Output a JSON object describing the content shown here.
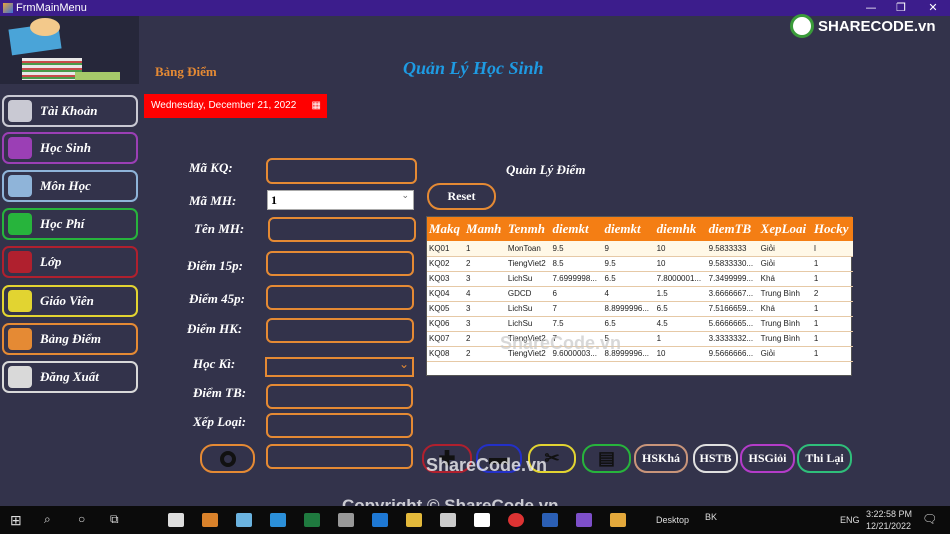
{
  "window": {
    "title": "FrmMainMenu",
    "controls": [
      "minimize",
      "restore",
      "close"
    ]
  },
  "watermark": {
    "logo": "SHARECODE.vn",
    "center": "ShareCode.vn",
    "copyright": "Copyright © ShareCode.vn"
  },
  "header": {
    "section": "Bảng Điểm",
    "title": "Quản Lý Học Sinh",
    "date": "Wednesday, December 21, 2022",
    "grid_title": "Quản Lý Điểm"
  },
  "sidebar": {
    "items": [
      {
        "label": "Tài Khoản",
        "color": "#c9c9d3",
        "icon": "user-icon"
      },
      {
        "label": "Học Sinh",
        "color": "#9b3fb5",
        "icon": "student-icon"
      },
      {
        "label": "Môn Học",
        "color": "#8fb4d9",
        "icon": "flask-icon"
      },
      {
        "label": "Học Phí",
        "color": "#27b43c",
        "icon": "money-icon"
      },
      {
        "label": "Lớp",
        "color": "#b0202e",
        "icon": "class-icon"
      },
      {
        "label": "Giáo Viên",
        "color": "#e2d431",
        "icon": "teacher-icon"
      },
      {
        "label": "Bảng Điểm",
        "color": "#e58a34",
        "icon": "report-icon"
      },
      {
        "label": "Đăng Xuất",
        "color": "#d9d9d9",
        "icon": "power-icon"
      }
    ]
  },
  "form": {
    "ma_kq": "Mã KQ:",
    "ma_mh": "Mã MH:",
    "ma_mh_value": "1",
    "ten_mh": "Tên MH:",
    "diem15": "Điểm 15p:",
    "diem45": "Điểm 45p:",
    "diemhk": "Điểm HK:",
    "hocki": "Học Kì:",
    "diemtb": "Điểm TB:",
    "xeploai": "Xếp Loại:"
  },
  "buttons": {
    "reset": "Reset",
    "hskha": "HSKhá",
    "hstb": "HSTB",
    "hsgioi": "HSGiỏi",
    "thilai": "Thi Lại"
  },
  "table": {
    "columns": [
      "Makq",
      "Mamh",
      "Tenmh",
      "diemkt",
      "diemkt",
      "diemhk",
      "diemTB",
      "XepLoai",
      "Hocky"
    ],
    "rows": [
      [
        "KQ01",
        "1",
        "MonToan",
        "9.5",
        "9",
        "10",
        "9.5833333",
        "Giỏi",
        "I"
      ],
      [
        "KQ02",
        "2",
        "TiengViet2",
        "8.5",
        "9.5",
        "10",
        "9.5833330...",
        "Giỏi",
        "1"
      ],
      [
        "KQ03",
        "3",
        "LichSu",
        "7.6999998...",
        "6.5",
        "7.8000001...",
        "7.3499999...",
        "Khá",
        "1"
      ],
      [
        "KQ04",
        "4",
        "GDCD",
        "6",
        "4",
        "1.5",
        "3.6666667...",
        "Trung Bình",
        "2"
      ],
      [
        "KQ05",
        "3",
        "LichSu",
        "7",
        "8.8999996...",
        "6.5",
        "7.5166659...",
        "Khá",
        "1"
      ],
      [
        "KQ06",
        "3",
        "LichSu",
        "7.5",
        "6.5",
        "4.5",
        "5.6666665...",
        "Trung Bình",
        "1"
      ],
      [
        "KQ07",
        "2",
        "TiengViet2",
        "7",
        "5",
        "1",
        "3.3333332...",
        "Trung Bình",
        "1"
      ],
      [
        "KQ08",
        "2",
        "TiengViet2",
        "9.6000003...",
        "8.8999996...",
        "10",
        "9.5666666...",
        "Giỏi",
        "1"
      ]
    ]
  },
  "taskbar": {
    "desktop": "Desktop",
    "user": "BK",
    "lang": "ENG",
    "time": "3:22:58 PM",
    "date": "12/21/2022"
  }
}
